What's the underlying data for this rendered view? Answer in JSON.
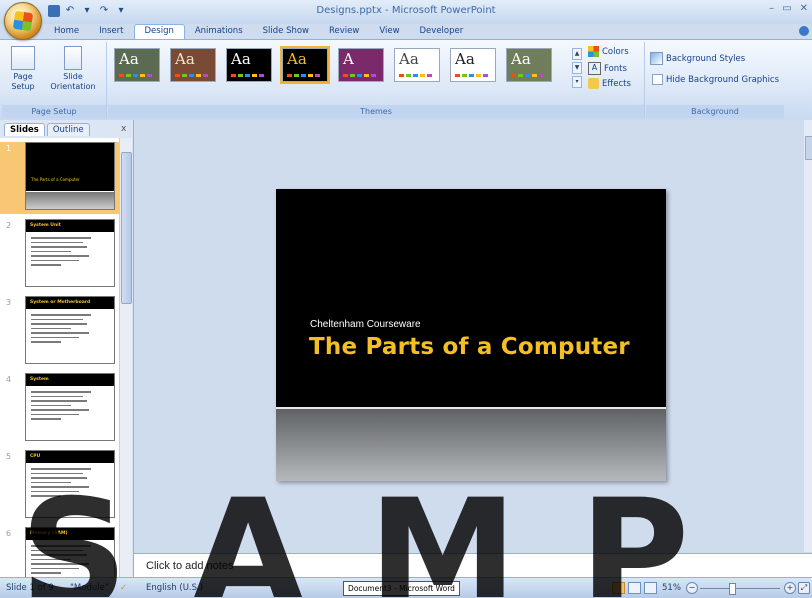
{
  "window": {
    "title": "Designs.pptx - Microsoft PowerPoint",
    "controls": [
      "–",
      "▭",
      "✕"
    ]
  },
  "ribbon_tabs": [
    "Home",
    "Insert",
    "Design",
    "Animations",
    "Slide Show",
    "Review",
    "View",
    "Developer"
  ],
  "active_tab": "Design",
  "page_setup": {
    "page_setup_label": "Page Setup",
    "slide_orientation_label": "Slide Orientation",
    "group_label": "Page Setup"
  },
  "themes": {
    "group_label": "Themes",
    "items": [
      {
        "text": "Aa",
        "bg": "#5a6b52",
        "fg": "#ffffff"
      },
      {
        "text": "Aa",
        "bg": "#7a4b34",
        "fg": "#f0e6d0"
      },
      {
        "text": "Aa",
        "bg": "#000000",
        "fg": "#ffffff"
      },
      {
        "text": "Aa",
        "bg": "#000000",
        "fg": "#f4bf24"
      },
      {
        "text": "A",
        "bg": "#7a2a6a",
        "fg": "#ffffff"
      },
      {
        "text": "Aa",
        "bg": "#ffffff",
        "fg": "#444444"
      },
      {
        "text": "Aa",
        "bg": "#ffffff",
        "fg": "#222222"
      },
      {
        "text": "Aa",
        "bg": "#6f7d5a",
        "fg": "#ffffff"
      }
    ],
    "colors_label": "Colors",
    "fonts_label": "Fonts",
    "effects_label": "Effects"
  },
  "background": {
    "styles_label": "Background Styles",
    "hide_label": "Hide Background Graphics",
    "group_label": "Background"
  },
  "pane": {
    "tab_slides": "Slides",
    "tab_outline": "Outline",
    "close": "x",
    "slides": [
      {
        "num": "1",
        "title": "The Parts of a Computer",
        "type": "title"
      },
      {
        "num": "2",
        "title": "System Unit",
        "type": "content"
      },
      {
        "num": "3",
        "title": "System or Motherboard",
        "type": "content"
      },
      {
        "num": "4",
        "title": "System",
        "type": "content"
      },
      {
        "num": "5",
        "title": "CPU",
        "type": "content"
      },
      {
        "num": "6",
        "title": "Memory (RAM)",
        "type": "content"
      }
    ]
  },
  "slide": {
    "subtitle": "Cheltenham Courseware",
    "title": "The Parts of a Computer"
  },
  "notes": {
    "placeholder": "Click to add notes"
  },
  "status": {
    "slide_info": "Slide 1 of 9",
    "theme": "\"Module\"",
    "language": "English (U.S.)",
    "taskbar_item": "Document3 - Microsoft Word",
    "zoom": "51%",
    "zoom_fraction": 0.4
  }
}
